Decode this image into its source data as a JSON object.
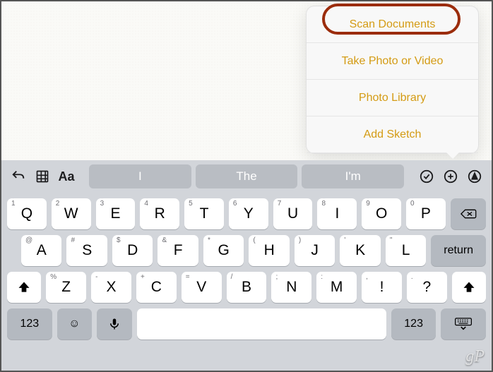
{
  "popup": {
    "items": [
      {
        "label": "Scan Documents"
      },
      {
        "label": "Take Photo or Video"
      },
      {
        "label": "Photo Library"
      },
      {
        "label": "Add Sketch"
      }
    ],
    "highlighted_index": 0
  },
  "suggestion_bar": {
    "suggestions": [
      "I",
      "The",
      "I'm"
    ]
  },
  "keyboard": {
    "row1": [
      {
        "main": "Q",
        "sub": "1"
      },
      {
        "main": "W",
        "sub": "2"
      },
      {
        "main": "E",
        "sub": "3"
      },
      {
        "main": "R",
        "sub": "4"
      },
      {
        "main": "T",
        "sub": "5"
      },
      {
        "main": "Y",
        "sub": "6"
      },
      {
        "main": "U",
        "sub": "7"
      },
      {
        "main": "I",
        "sub": "8"
      },
      {
        "main": "O",
        "sub": "9"
      },
      {
        "main": "P",
        "sub": "0"
      }
    ],
    "row2": [
      {
        "main": "A",
        "sub": "@"
      },
      {
        "main": "S",
        "sub": "#"
      },
      {
        "main": "D",
        "sub": "$"
      },
      {
        "main": "F",
        "sub": "&"
      },
      {
        "main": "G",
        "sub": "*"
      },
      {
        "main": "H",
        "sub": "("
      },
      {
        "main": "J",
        "sub": ")"
      },
      {
        "main": "K",
        "sub": "'"
      },
      {
        "main": "L",
        "sub": "\""
      }
    ],
    "return_label": "return",
    "row3": [
      {
        "main": "Z",
        "sub": "%"
      },
      {
        "main": "X",
        "sub": "-"
      },
      {
        "main": "C",
        "sub": "+"
      },
      {
        "main": "V",
        "sub": "="
      },
      {
        "main": "B",
        "sub": "/"
      },
      {
        "main": "N",
        "sub": ";"
      },
      {
        "main": "M",
        "sub": ":"
      },
      {
        "main": "!",
        "sub": ","
      },
      {
        "main": "?",
        "sub": "."
      }
    ],
    "nums_label": "123"
  },
  "watermark": "gP"
}
